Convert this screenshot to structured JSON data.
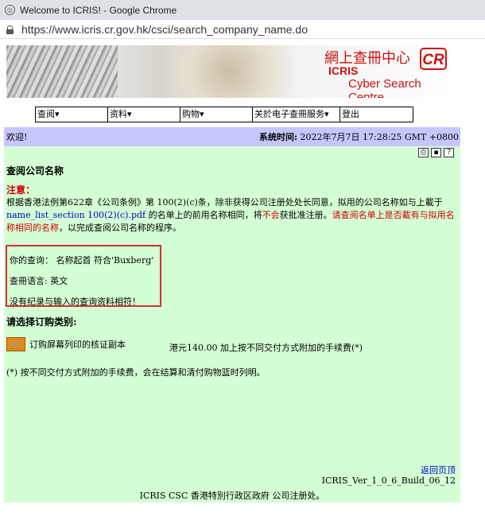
{
  "browser": {
    "title": "Welcome to ICRIS! - Google Chrome",
    "url": "https://www.icris.cr.gov.hk/csci/search_company_name.do"
  },
  "banner": {
    "brand_chinese": "網上查冊中心",
    "brand_badge": "CR",
    "brand_icris": "ICRIS",
    "brand_english": "Cyber Search Centre"
  },
  "menu": {
    "items": [
      {
        "label": "查阅▾"
      },
      {
        "label": "资料▾"
      },
      {
        "label": "购物▾"
      },
      {
        "label": "关於电子查冊服务▾"
      },
      {
        "label": "登出"
      }
    ]
  },
  "topstrip": {
    "welcome": "欢迎!",
    "time_label": "系统时间:",
    "time_value": " 2022年7月7日 17:28:25 GMT +0800"
  },
  "page": {
    "title": "查阅公司名称",
    "note_label": "注意：",
    "note_text1": "根据香港法例第622章《公司条例》第 100(2)(c)条，除非获得公司注册处处长同意，拟用的公司名称如与上載于",
    "note_link": "name_list_section 100(2)(c).pdf",
    "note_text2": " 的名单上的前用名称相同，将",
    "note_red1": "不会",
    "note_text3": "获批准注册。",
    "note_red2": "请查阅名单上是否載有与拟用名称相同的名称",
    "note_text4": "，以完成查阅公司名称的程序。",
    "query": "你的查询：  名称起首 符合'Buxberg'",
    "language": "查冊语言: 英文",
    "no_record": "没有纪录与输入的查询资料相符！",
    "choose": "请选择订购类别:",
    "order_item": "订购屏幕列印的核证副本",
    "order_price": "港元140.00 加上按不同交付方式附加的手续费(*)",
    "footnote": "(*) 按不同交付方式附加的手续费，会在结算和清付购物篮时列明。",
    "back_to_top": "返回页顶",
    "build": "ICRIS_Ver_1_0_6_Build_06_12",
    "footer": "ICRIS CSC 香港特別行政区政府 公司注册处。"
  }
}
